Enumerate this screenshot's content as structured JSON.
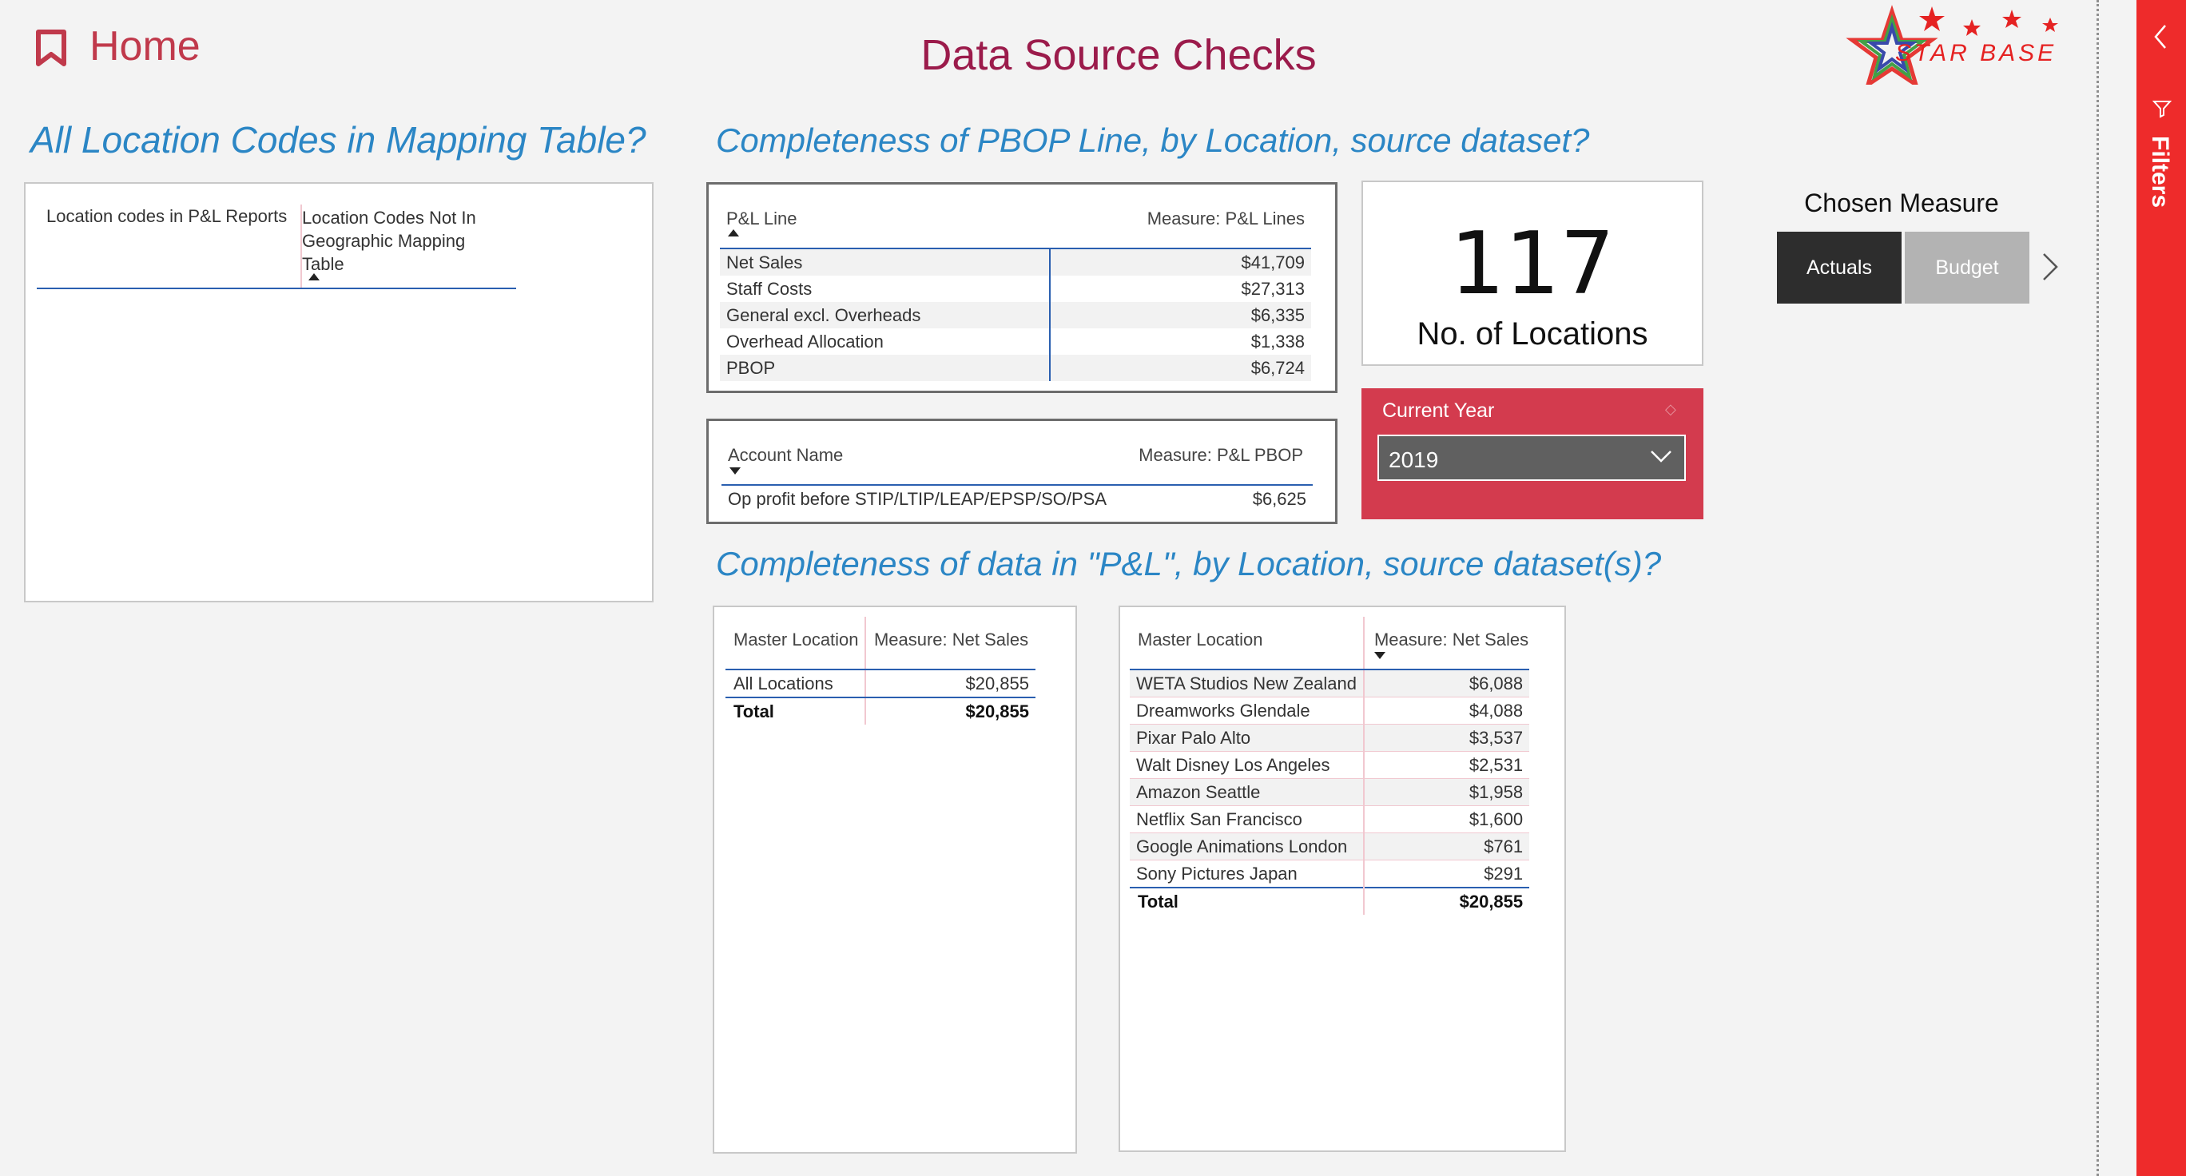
{
  "header": {
    "home_label": "Home",
    "title": "Data Source Checks",
    "logo_text": "STAR BASE"
  },
  "sections": {
    "location_codes": "All Location Codes in Mapping Table?",
    "pbop": "Completeness of PBOP Line, by Location, source dataset?",
    "pl_data": "Completeness of data in \"P&L\", by Location, source dataset(s)?"
  },
  "location_codes_table": {
    "col1": "Location codes in P&L Reports",
    "col2": "Location Codes Not In Geographic Mapping Table"
  },
  "pbop_lines_table": {
    "col1": "P&L Line",
    "col2": "Measure: P&L Lines",
    "rows": [
      {
        "label": "Net Sales",
        "value": "$41,709"
      },
      {
        "label": "Staff Costs",
        "value": "$27,313"
      },
      {
        "label": "General excl. Overheads",
        "value": "$6,335"
      },
      {
        "label": "Overhead Allocation",
        "value": "$1,338"
      },
      {
        "label": "PBOP",
        "value": "$6,724"
      }
    ]
  },
  "pbop_account_table": {
    "col1": "Account Name",
    "col2": "Measure: P&L PBOP",
    "rows": [
      {
        "label": "Op profit before STIP/LTIP/LEAP/EPSP/SO/PSA",
        "value": "$6,625"
      }
    ]
  },
  "card": {
    "value": "117",
    "label": "No. of Locations"
  },
  "slicer": {
    "title": "Current Year",
    "value": "2019"
  },
  "chosen_measure": {
    "title": "Chosen Measure",
    "options": [
      "Actuals",
      "Budget"
    ],
    "selected": "Actuals"
  },
  "master_location_total_table": {
    "col1": "Master Location",
    "col2": "Measure: Net Sales",
    "rows": [
      {
        "label": "All Locations",
        "value": "$20,855"
      }
    ],
    "total_label": "Total",
    "total_value": "$20,855"
  },
  "master_location_table": {
    "col1": "Master Location",
    "col2": "Measure: Net Sales",
    "rows": [
      {
        "label": "WETA Studios New Zealand",
        "value": "$6,088"
      },
      {
        "label": "Dreamworks Glendale",
        "value": "$4,088"
      },
      {
        "label": "Pixar Palo Alto",
        "value": "$3,537"
      },
      {
        "label": "Walt Disney Los Angeles",
        "value": "$2,531"
      },
      {
        "label": "Amazon Seattle",
        "value": "$1,958"
      },
      {
        "label": "Netflix San Francisco",
        "value": "$1,600"
      },
      {
        "label": "Google Animations London",
        "value": "$761"
      },
      {
        "label": "Sony Pictures Japan",
        "value": "$291"
      }
    ],
    "total_label": "Total",
    "total_value": "$20,855"
  },
  "filters_pane": {
    "label": "Filters"
  },
  "colors": {
    "accent_red": "#d33b4e",
    "filters_red": "#ee2b2b",
    "title_blue": "#2b86c5",
    "page_title": "#9b1b4b"
  }
}
